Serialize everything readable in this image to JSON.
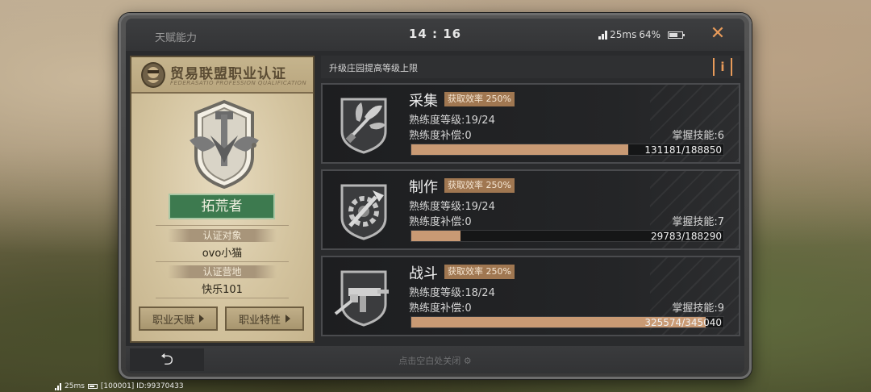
{
  "topbar": {
    "title": "天赋能力",
    "time": "14 : 16",
    "network": "25ms",
    "battery": "64%",
    "close_icon": "close-icon"
  },
  "certificate": {
    "title": "贸易联盟职业认证",
    "subtitle": "FEDERASATIO PROFESSION QUALIFICATION",
    "rank": "拓荒者",
    "target_label": "认证对象",
    "target_value": "ovo小猫",
    "camp_label": "认证营地",
    "camp_value": "快乐101",
    "talent_button": "职业天赋",
    "trait_button": "职业特性"
  },
  "header": {
    "text": "升级庄园提高等级上限",
    "info_label": "i"
  },
  "skills": [
    {
      "name": "采集",
      "efficiency": "获取效率 250%",
      "level": "熟练度等级:19/24",
      "compensation": "熟练度补偿:0",
      "mastery": "掌握技能:6",
      "progress_text": "131181/188850",
      "progress": 0.6946,
      "icon": "gathering-icon"
    },
    {
      "name": "制作",
      "efficiency": "获取效率 250%",
      "level": "熟练度等级:19/24",
      "compensation": "熟练度补偿:0",
      "mastery": "掌握技能:7",
      "progress_text": "29783/188290",
      "progress": 0.1582,
      "icon": "crafting-icon"
    },
    {
      "name": "战斗",
      "efficiency": "获取效率 250%",
      "level": "熟练度等级:18/24",
      "compensation": "熟练度补偿:0",
      "mastery": "掌握技能:9",
      "progress_text": "325574/345040",
      "progress": 0.9436,
      "icon": "combat-icon"
    }
  ],
  "footer": {
    "back_icon": "back-icon",
    "hint": "点击空白处关闭 ⚙"
  },
  "system_status": {
    "network": "25ms",
    "info": "[100001] ID:99370433"
  },
  "colors": {
    "accent": "#e89b5a",
    "progress": "#c99a74",
    "rank_green": "#3d7a4f",
    "badge_brown": "#a07751"
  }
}
